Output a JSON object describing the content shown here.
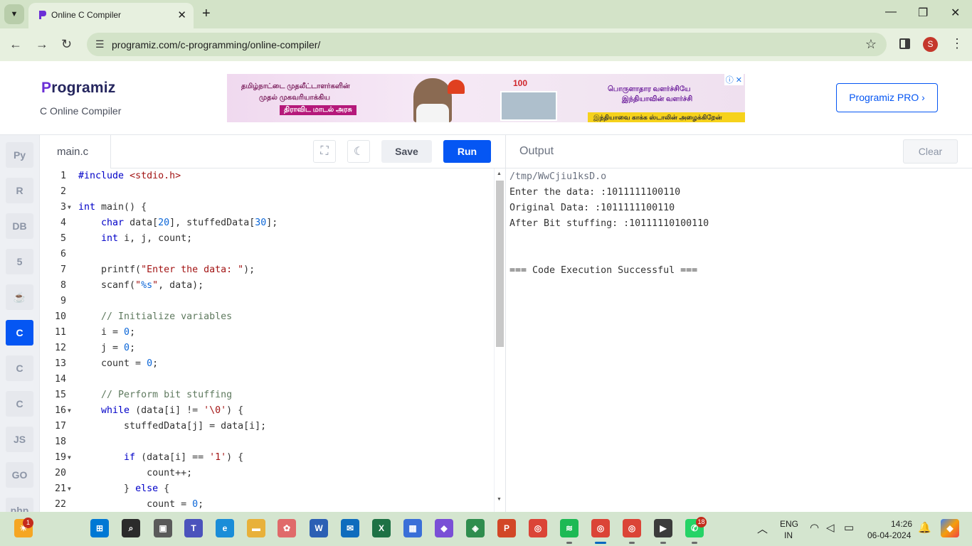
{
  "browser": {
    "tab_title": "Online C Compiler",
    "url": "programiz.com/c-programming/online-compiler/",
    "profile_initial": "S",
    "new_tab_label": "+"
  },
  "site": {
    "logo_text": "rogramiz",
    "logo_initial": "P",
    "subtitle": "C Online Compiler",
    "pro_button": "Programiz PRO ›",
    "ad": {
      "line1": "தமிழ்நாட்டை முதலீட்டாளர்களின்",
      "line2": "முதல் முகவரியாக்கிய",
      "line3": "திராவிட மாடல் அரசு",
      "line4": "பொருளாதார வளர்ச்சியே",
      "line5": "இந்தியாவின் வளர்ச்சி",
      "line6": "இந்தியாவை காக்க ஸ்டாலின் அழைக்கிறேன்",
      "badge": "100"
    }
  },
  "languages": [
    {
      "icon": "python-icon",
      "glyph": "Py",
      "active": false
    },
    {
      "icon": "r-icon",
      "glyph": "R",
      "active": false
    },
    {
      "icon": "sql-icon",
      "glyph": "DB",
      "active": false
    },
    {
      "icon": "html5-icon",
      "glyph": "5",
      "active": false
    },
    {
      "icon": "java-icon",
      "glyph": "☕",
      "active": false
    },
    {
      "icon": "c-icon",
      "glyph": "C",
      "active": true
    },
    {
      "icon": "cpp-icon",
      "glyph": "C",
      "active": false
    },
    {
      "icon": "csharp-icon",
      "glyph": "C",
      "active": false
    },
    {
      "icon": "javascript-icon",
      "glyph": "JS",
      "active": false
    },
    {
      "icon": "go-icon",
      "glyph": "GO",
      "active": false
    },
    {
      "icon": "php-icon",
      "glyph": "php",
      "active": false
    }
  ],
  "editor": {
    "filename": "main.c",
    "save_label": "Save",
    "run_label": "Run",
    "lines": [
      {
        "n": "1",
        "fold": false,
        "html": "<span class='kw'>#include</span> <span class='str'>&lt;stdio.h&gt;</span>"
      },
      {
        "n": "2",
        "fold": false,
        "html": ""
      },
      {
        "n": "3",
        "fold": true,
        "html": "<span class='ty'>int</span> main() {"
      },
      {
        "n": "4",
        "fold": false,
        "html": "    <span class='ty'>char</span> data[<span class='num'>20</span>], stuffedData[<span class='num'>30</span>];"
      },
      {
        "n": "5",
        "fold": false,
        "html": "    <span class='ty'>int</span> i, j, count;"
      },
      {
        "n": "6",
        "fold": false,
        "html": ""
      },
      {
        "n": "7",
        "fold": false,
        "html": "    printf(<span class='str'>\"Enter the data: \"</span>);"
      },
      {
        "n": "8",
        "fold": false,
        "html": "    scanf(<span class='str'>\"<span class='fmt'>%s</span>\"</span>, data);"
      },
      {
        "n": "9",
        "fold": false,
        "html": ""
      },
      {
        "n": "10",
        "fold": false,
        "html": "    <span class='com'>// Initialize variables</span>"
      },
      {
        "n": "11",
        "fold": false,
        "html": "    i = <span class='num'>0</span>;"
      },
      {
        "n": "12",
        "fold": false,
        "html": "    j = <span class='num'>0</span>;"
      },
      {
        "n": "13",
        "fold": false,
        "html": "    count = <span class='num'>0</span>;"
      },
      {
        "n": "14",
        "fold": false,
        "html": ""
      },
      {
        "n": "15",
        "fold": false,
        "html": "    <span class='com'>// Perform bit stuffing</span>"
      },
      {
        "n": "16",
        "fold": true,
        "html": "    <span class='kw'>while</span> (data[i] != <span class='str'>'\\0'</span>) {"
      },
      {
        "n": "17",
        "fold": false,
        "html": "        stuffedData[j] = data[i];"
      },
      {
        "n": "18",
        "fold": false,
        "html": ""
      },
      {
        "n": "19",
        "fold": true,
        "html": "        <span class='kw'>if</span> (data[i] == <span class='str'>'1'</span>) {"
      },
      {
        "n": "20",
        "fold": false,
        "html": "            count++;"
      },
      {
        "n": "21",
        "fold": true,
        "html": "        } <span class='kw'>else</span> {"
      },
      {
        "n": "22",
        "fold": false,
        "html": "            count = <span class='num'>0</span>;"
      }
    ]
  },
  "output": {
    "title": "Output",
    "clear_label": "Clear",
    "lines": [
      {
        "text": "/tmp/WwCjiu1ksD.o",
        "path": true
      },
      {
        "text": "Enter the data: :1011111100110",
        "path": false
      },
      {
        "text": "Original Data: :1011111100110",
        "path": false
      },
      {
        "text": "After Bit stuffing: :10111110100110",
        "path": false
      },
      {
        "text": "",
        "path": false
      },
      {
        "text": "",
        "path": false
      },
      {
        "text": "=== Code Execution Successful ===",
        "path": false
      }
    ]
  },
  "taskbar": {
    "lang_top": "ENG",
    "lang_bottom": "IN",
    "time": "14:26",
    "date": "06-04-2024",
    "weather_badge": "1",
    "whatsapp_badge": "18",
    "apps": [
      {
        "name": "start-icon",
        "glyph": "⊞",
        "color": "#0078d4",
        "open": false,
        "active": false
      },
      {
        "name": "search-icon",
        "glyph": "⌕",
        "color": "#2b2b2b",
        "open": false,
        "active": false
      },
      {
        "name": "task-view-icon",
        "glyph": "▣",
        "color": "#5a5a5a",
        "open": false,
        "active": false
      },
      {
        "name": "teams-icon",
        "glyph": "T",
        "color": "#4b53bc",
        "open": false,
        "active": false
      },
      {
        "name": "edge-icon",
        "glyph": "e",
        "color": "#1a8dd8",
        "open": false,
        "active": false
      },
      {
        "name": "file-explorer-icon",
        "glyph": "▬",
        "color": "#e8b13a",
        "open": false,
        "active": false
      },
      {
        "name": "app-icon",
        "glyph": "✿",
        "color": "#e06a6a",
        "open": false,
        "active": false
      },
      {
        "name": "word-icon",
        "glyph": "W",
        "color": "#2b5fb4",
        "open": false,
        "active": false
      },
      {
        "name": "mail-icon",
        "glyph": "✉",
        "color": "#0f6cbd",
        "open": false,
        "active": false
      },
      {
        "name": "excel-icon",
        "glyph": "X",
        "color": "#1e7145",
        "open": false,
        "active": false
      },
      {
        "name": "store-icon",
        "glyph": "▦",
        "color": "#3a6fd8",
        "open": false,
        "active": false
      },
      {
        "name": "game-icon",
        "glyph": "◆",
        "color": "#7a4fd6",
        "open": false,
        "active": false
      },
      {
        "name": "maps-icon",
        "glyph": "◈",
        "color": "#2f8d4e",
        "open": false,
        "active": false
      },
      {
        "name": "powerpoint-icon",
        "glyph": "P",
        "color": "#d24726",
        "open": false,
        "active": false
      },
      {
        "name": "chrome-icon",
        "glyph": "◎",
        "color": "#db4437",
        "open": false,
        "active": false
      },
      {
        "name": "spotify-icon",
        "glyph": "≋",
        "color": "#1db954",
        "open": true,
        "active": false
      },
      {
        "name": "chrome-profile-icon",
        "glyph": "◎",
        "color": "#db4437",
        "open": true,
        "active": true
      },
      {
        "name": "chrome-profile2-icon",
        "glyph": "◎",
        "color": "#db4437",
        "open": true,
        "active": false
      },
      {
        "name": "terminal-icon",
        "glyph": "▶",
        "color": "#3b3b3b",
        "open": true,
        "active": false
      },
      {
        "name": "whatsapp-icon",
        "glyph": "✆",
        "color": "#25d366",
        "open": true,
        "active": false
      }
    ]
  }
}
